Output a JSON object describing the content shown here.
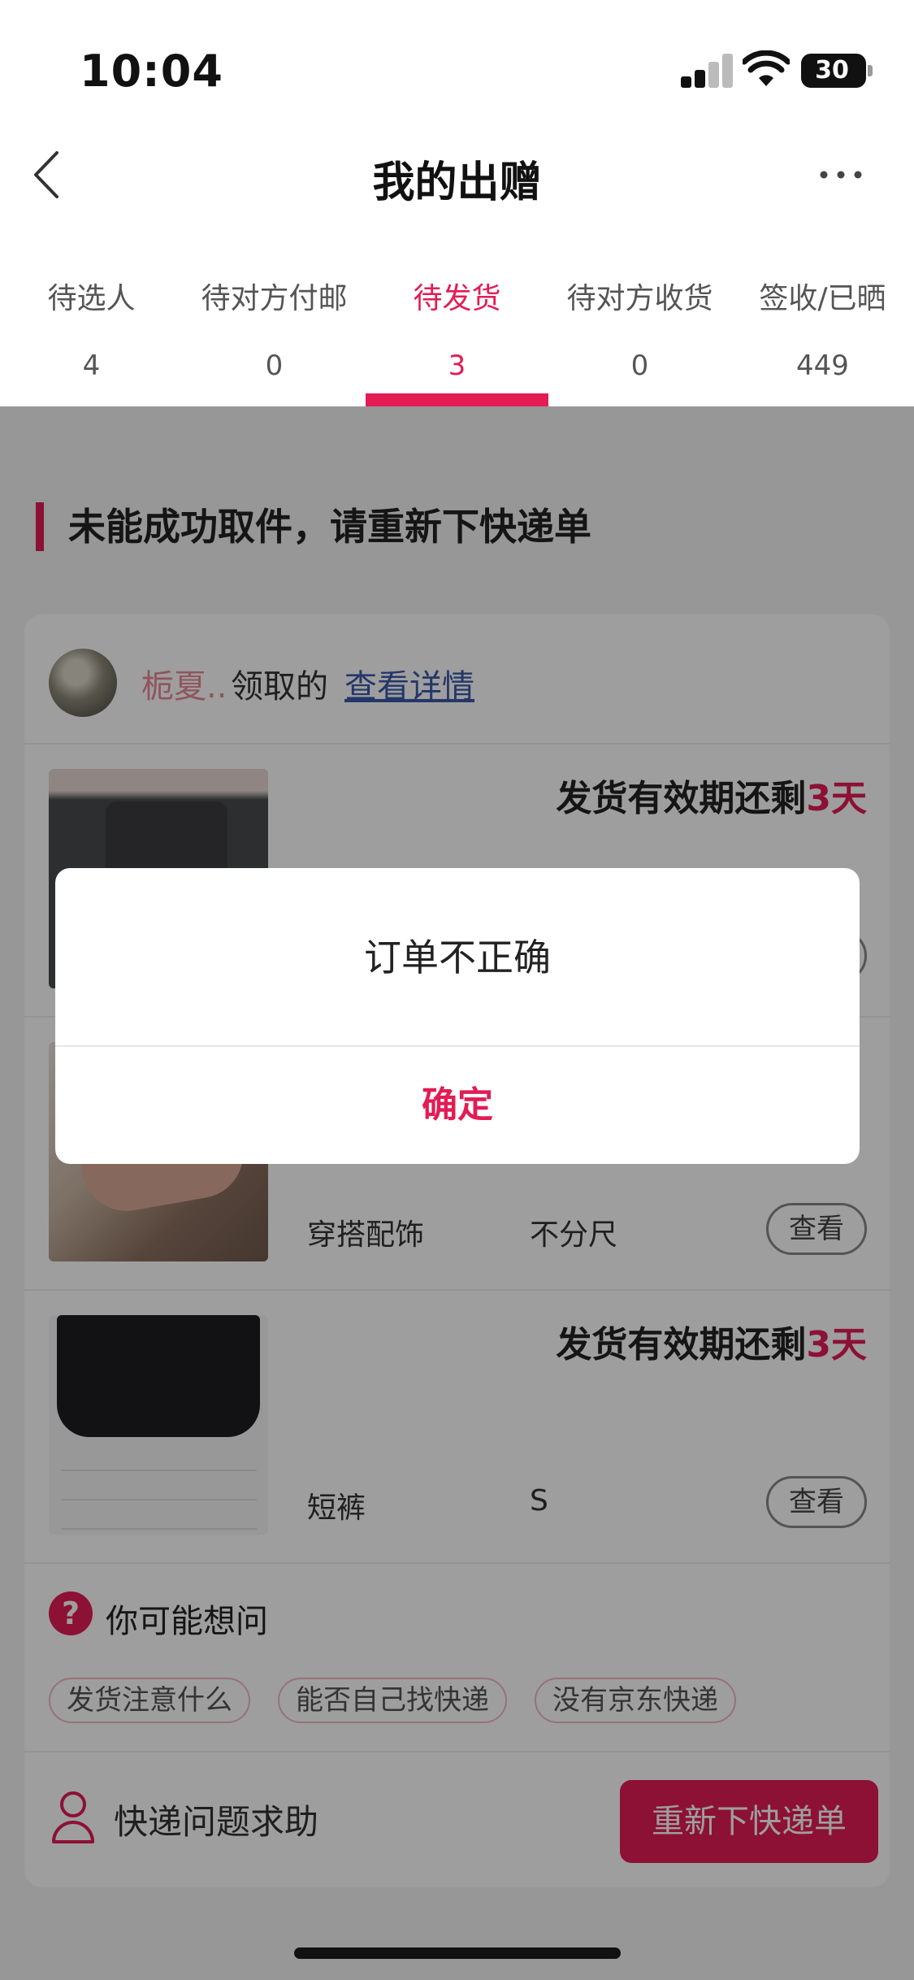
{
  "status_bar": {
    "time": "10:04",
    "battery": "30"
  },
  "nav": {
    "title": "我的出赠"
  },
  "tabs": [
    {
      "label": "待选人",
      "count": "4",
      "active": false
    },
    {
      "label": "待对方付邮",
      "count": "0",
      "active": false
    },
    {
      "label": "待发货",
      "count": "3",
      "active": true
    },
    {
      "label": "待对方收货",
      "count": "0",
      "active": false
    },
    {
      "label": "签收/已晒",
      "count": "449",
      "active": false
    }
  ],
  "section": {
    "title": "未能成功取件，请重新下快递单"
  },
  "card": {
    "receiver": {
      "name": "栀夏..",
      "suffix": "领取的",
      "link": "查看详情"
    },
    "items": [
      {
        "deadline_prefix": "发货有效期还剩",
        "deadline_days": "3天",
        "category": "",
        "size": "",
        "view": "查看"
      },
      {
        "deadline_prefix": "",
        "deadline_days": "",
        "category": "穿搭配饰",
        "size": "不分尺",
        "view": "查看"
      },
      {
        "deadline_prefix": "发货有效期还剩",
        "deadline_days": "3天",
        "category": "短裤",
        "size": "S",
        "view": "查看"
      }
    ],
    "faq": {
      "title": "你可能想问",
      "icon": "?",
      "chips": [
        "发货注意什么",
        "能否自己找快递",
        "没有京东快递"
      ]
    },
    "help": {
      "text": "快递问题求助",
      "button": "重新下快递单"
    }
  },
  "dialog": {
    "message": "订单不正确",
    "confirm": "确定"
  },
  "colors": {
    "accent": "#e31c54",
    "overlay": "rgba(0,0,0,0.38)"
  }
}
